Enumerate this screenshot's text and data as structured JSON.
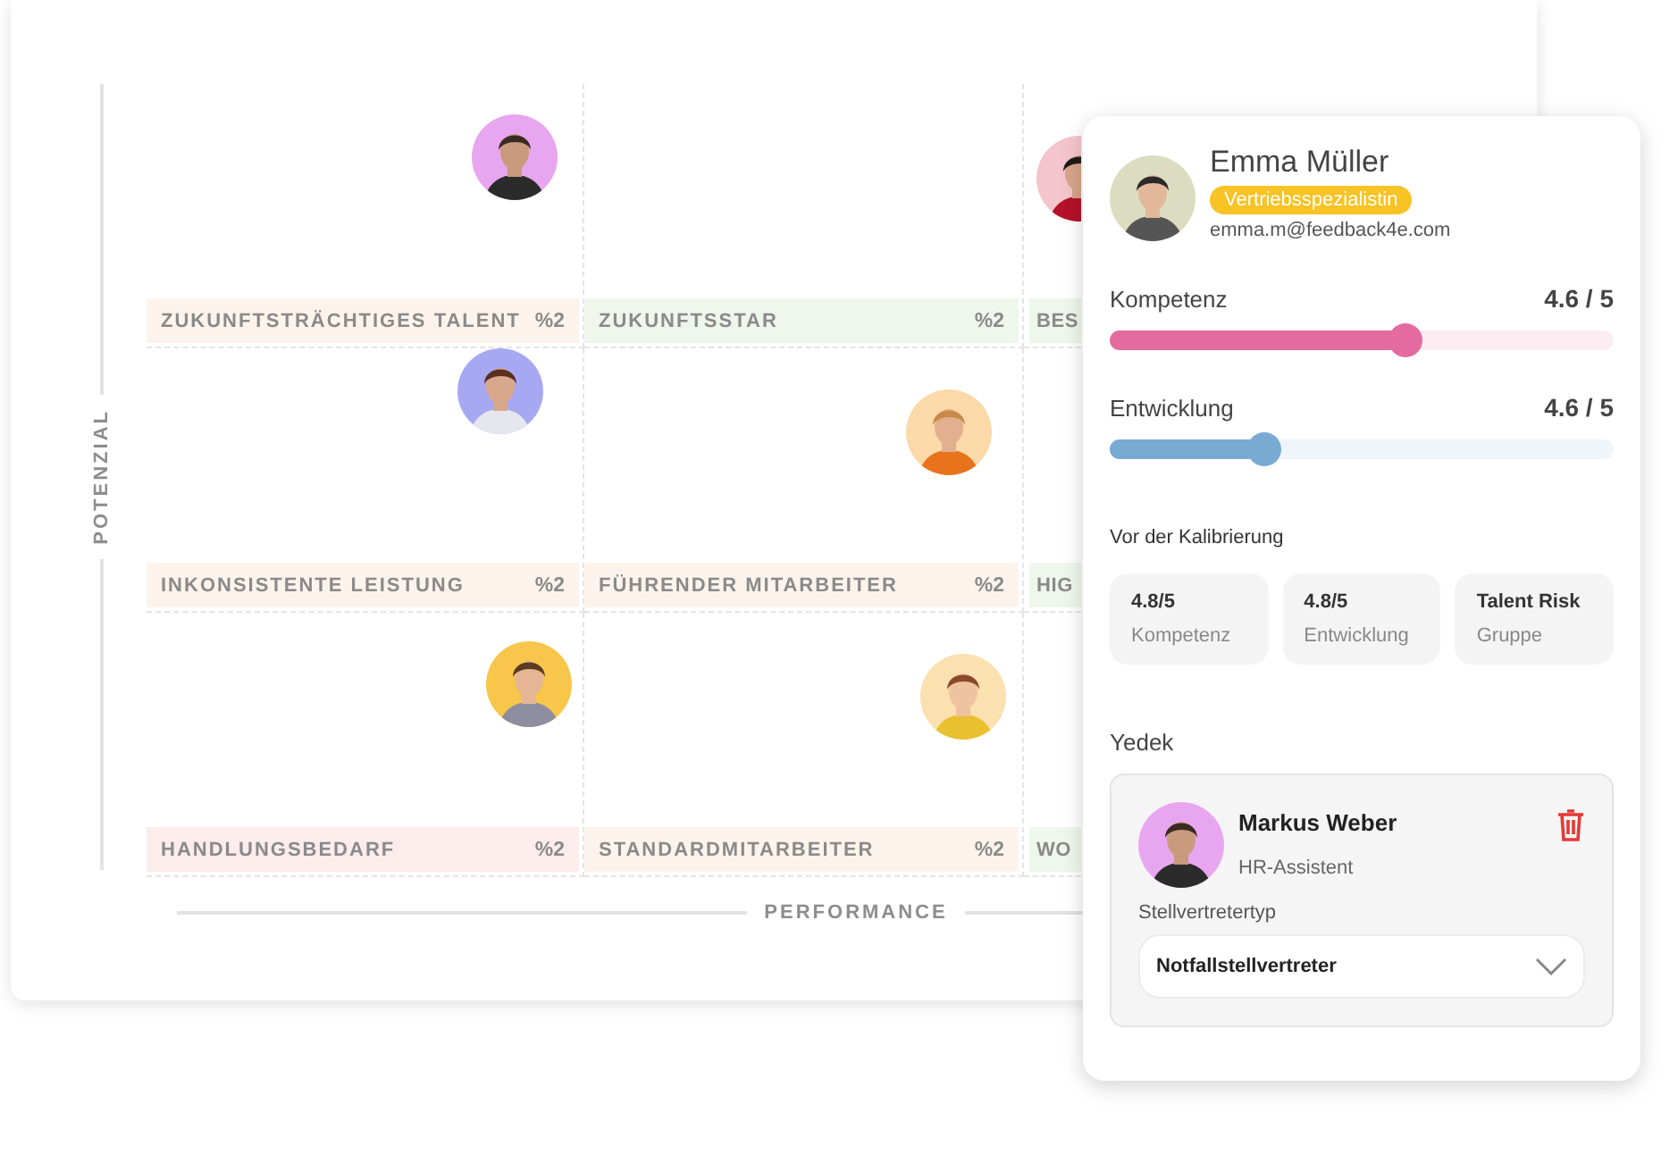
{
  "grid": {
    "y_axis": "POTENZIAL",
    "x_axis": "PERFORMANCE",
    "rows": [
      {
        "cells": [
          {
            "label": "ZUKUNFTSTRÄCHTIGES TALENT",
            "share": "%2",
            "color": "#fcf4ec"
          },
          {
            "label": "ZUKUNFTSSTAR",
            "share": "%2",
            "color": "#eff7ec"
          },
          {
            "label": "BES",
            "color": "#eff7ec"
          }
        ]
      },
      {
        "cells": [
          {
            "label": "INKONSISTENTE LEISTUNG",
            "share": "%2",
            "color": "#fcf4ec"
          },
          {
            "label": "FÜHRENDER MITARBEITER",
            "share": "%2",
            "color": "#fcf4ec"
          },
          {
            "label": "HIG",
            "color": "#eff7ec"
          }
        ]
      },
      {
        "cells": [
          {
            "label": "HANDLUNGSBEDARF",
            "share": "%2",
            "color": "#fcecec"
          },
          {
            "label": "STANDARDMITARBEITER",
            "share": "%2",
            "color": "#fcf4ec"
          },
          {
            "label": "WO",
            "color": "#eff7ec"
          }
        ]
      }
    ]
  },
  "profile": {
    "name": "Emma Müller",
    "role": "Vertriebsspezialistin",
    "email": "emma.m@feedback4e.com",
    "sliders": [
      {
        "label": "Kompetenz",
        "reading": "4.6 / 5",
        "level": 0.59,
        "color": "#e46aa0"
      },
      {
        "label": "Entwicklung",
        "reading": "4.6 / 5",
        "level": 0.31,
        "color": "#78aad3"
      }
    ],
    "before_title": "Vor der Kalibrierung",
    "before": [
      {
        "value": "4.8/5",
        "label": "Kompetenz"
      },
      {
        "value": "4.8/5",
        "label": "Entwicklung"
      },
      {
        "value": "Talent Risk",
        "label": "Gruppe"
      }
    ],
    "backup_title": "Yedek",
    "backup": {
      "name": "Markus Weber",
      "role": "HR-Assistent",
      "type_label": "Stellvertretertyp",
      "type_value": "Notfallstellvertreter"
    }
  }
}
